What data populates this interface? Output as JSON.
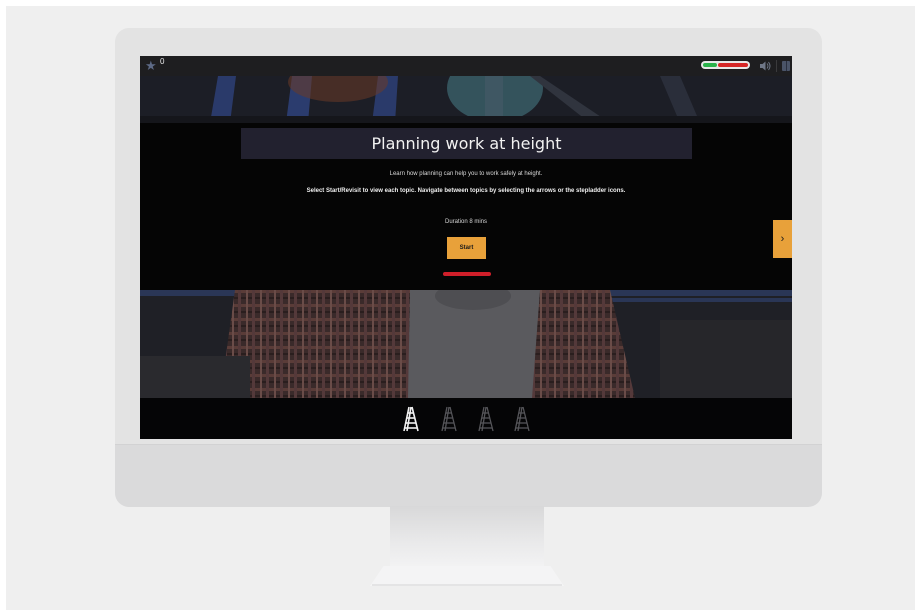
{
  "topbar": {
    "star_icon": "star-icon",
    "score": "0",
    "progress_fraction": 0.3,
    "sound_icon": "speaker-icon",
    "menu_icon": "menu-icon"
  },
  "content": {
    "title": "Planning work at height",
    "intro": "Learn how planning can help you to work safely at height.",
    "instruction": "Select Start/Revisit to view each topic. Navigate between topics by selecting the arrows or the stepladder icons.",
    "duration": "Duration 8 mins",
    "start_label": "Start",
    "next_arrow": "›"
  },
  "topics": [
    {
      "icon": "stepladder-icon",
      "active": true
    },
    {
      "icon": "stepladder-icon",
      "active": false
    },
    {
      "icon": "stepladder-icon",
      "active": false
    },
    {
      "icon": "stepladder-icon",
      "active": false
    }
  ],
  "colors": {
    "accent": "#e8a13a",
    "underline": "#d01f2a",
    "title_bg": "#22212f",
    "progress_green": "#2bb24b",
    "progress_red": "#d62727"
  }
}
